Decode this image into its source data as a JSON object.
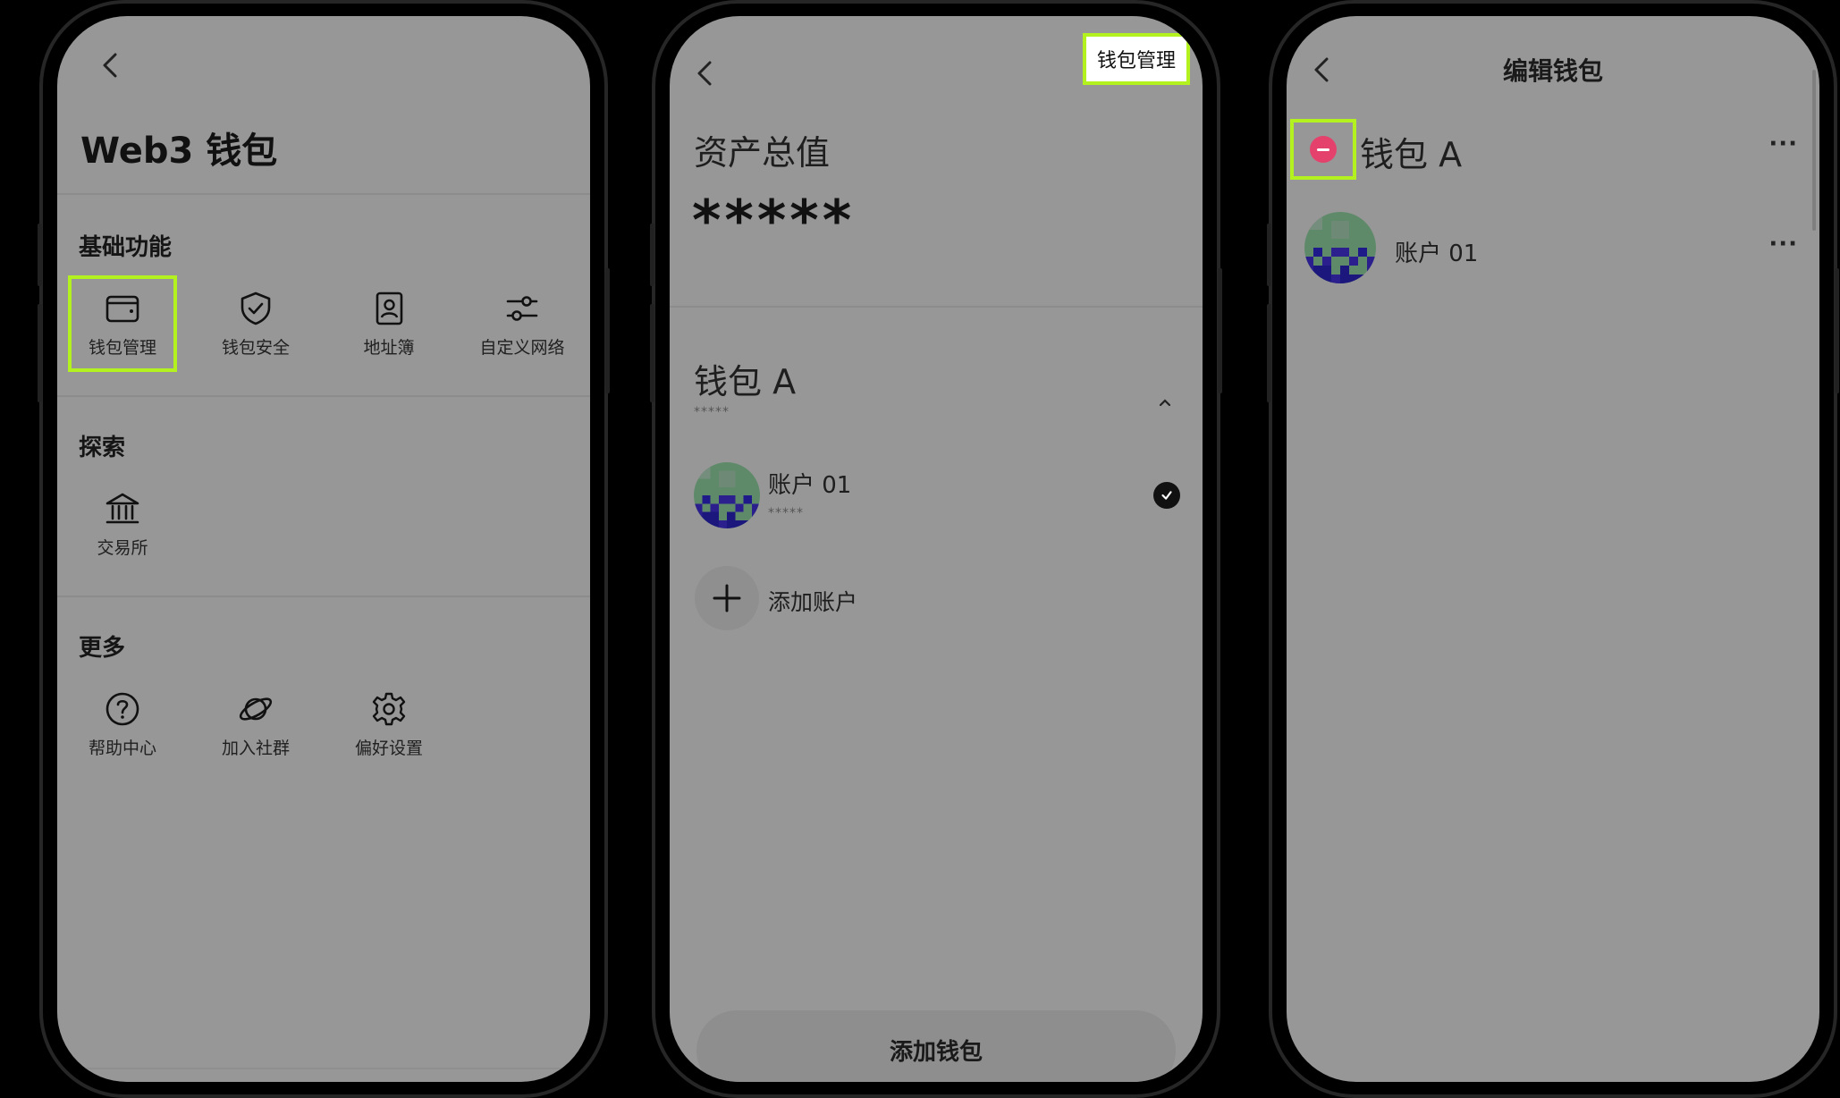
{
  "phone1": {
    "title": "Web3 钱包",
    "sections": {
      "basic": {
        "title": "基础功能",
        "items": [
          {
            "label": "钱包管理",
            "icon": "wallet-icon"
          },
          {
            "label": "钱包安全",
            "icon": "shield-check-icon"
          },
          {
            "label": "地址簿",
            "icon": "address-book-icon"
          },
          {
            "label": "自定义网络",
            "icon": "sliders-icon"
          }
        ]
      },
      "explore": {
        "title": "探索",
        "items": [
          {
            "label": "交易所",
            "icon": "bank-icon"
          }
        ]
      },
      "more": {
        "title": "更多",
        "items": [
          {
            "label": "帮助中心",
            "icon": "help-circle-icon"
          },
          {
            "label": "加入社群",
            "icon": "planet-icon"
          },
          {
            "label": "偏好设置",
            "icon": "gear-icon"
          }
        ]
      }
    }
  },
  "phone2": {
    "header_button": "钱包管理",
    "asset_label": "资产总值",
    "asset_value": "*****",
    "wallet": {
      "name": "钱包 A",
      "masked": "*****",
      "account": {
        "name": "账户 01",
        "masked": "*****"
      }
    },
    "add_account": "添加账户",
    "add_wallet": "添加钱包"
  },
  "phone3": {
    "title": "编辑钱包",
    "wallet_name": "钱包 A",
    "account_name": "账户 01",
    "more": "···"
  },
  "colors": {
    "screen_bg": "#979797",
    "highlight": "#b3f21e",
    "delete": "#e4416c"
  }
}
